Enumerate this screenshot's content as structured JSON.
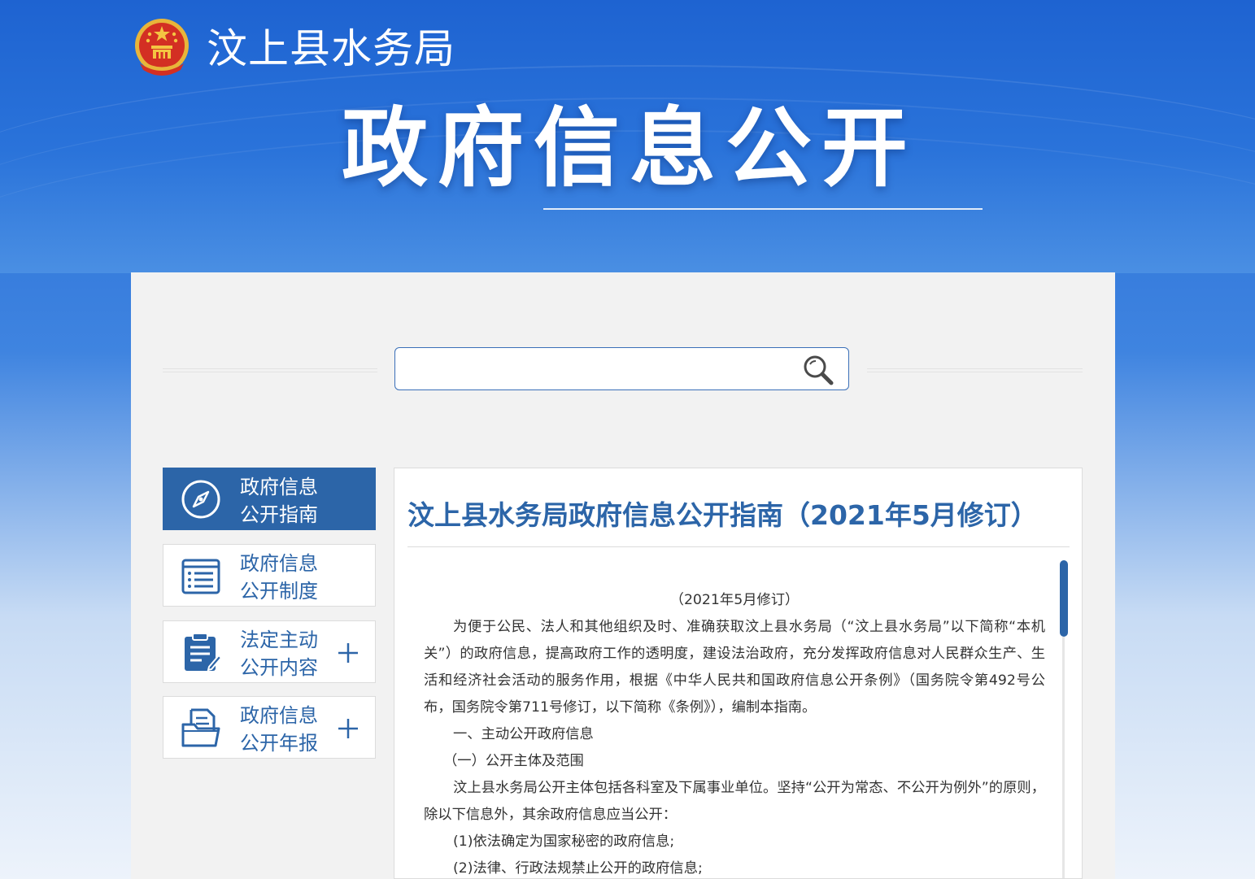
{
  "header": {
    "dept_name": "汶上县水务局",
    "main_title": "政府信息公开",
    "emblem_icon": "national-emblem-icon"
  },
  "search": {
    "placeholder": "",
    "icon": "search-icon"
  },
  "sidebar": {
    "items": [
      {
        "line1": "政府信息",
        "line2": "公开指南",
        "icon": "compass-icon",
        "active": true,
        "expandable": false
      },
      {
        "line1": "政府信息",
        "line2": "公开制度",
        "icon": "list-document-icon",
        "active": false,
        "expandable": false
      },
      {
        "line1": "法定主动",
        "line2": "公开内容",
        "icon": "clipboard-edit-icon",
        "active": false,
        "expandable": true
      },
      {
        "line1": "政府信息",
        "line2": "公开年报",
        "icon": "folder-document-icon",
        "active": false,
        "expandable": true
      }
    ],
    "expand_icon": "plus-icon"
  },
  "article": {
    "title": "汶上县水务局政府信息公开指南（2021年5月修订）",
    "paragraphs": [
      "（2021年5月修订）",
      "为便于公民、法人和其他组织及时、准确获取汶上县水务局（“汶上县水务局”以下简称“本机关”）的政府信息，提高政府工作的透明度，建设法治政府，充分发挥政府信息对人民群众生产、生活和经济社会活动的服务作用，根据《中华人民共和国政府信息公开条例》（国务院令第492号公布，国务院令第711号修订，以下简称《条例》），编制本指南。",
      "一、主动公开政府信息",
      "（一）公开主体及范围",
      "汶上县水务局公开主体包括各科室及下属事业单位。坚持“公开为常态、不公开为例外”的原则，除以下信息外，其余政府信息应当公开：",
      "(1)依法确定为国家秘密的政府信息;",
      "(2)法律、行政法规禁止公开的政府信息;"
    ]
  },
  "colors": {
    "brand_blue": "#2c65a8",
    "banner_blue": "#1e63d1",
    "panel_bg": "#f2f2f2",
    "body_text": "#333333"
  }
}
